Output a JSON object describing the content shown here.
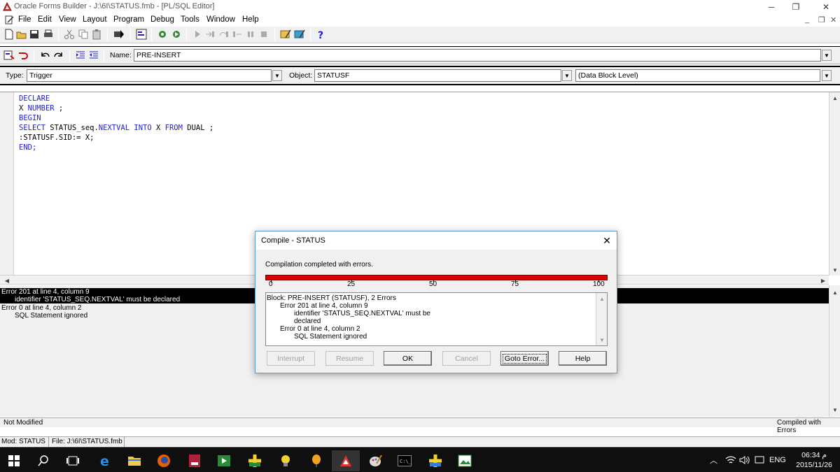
{
  "window": {
    "title": "Oracle Forms Builder - J:\\6I\\STATUS.fmb - [PL/SQL Editor]",
    "controls": {
      "minimize": "─",
      "restore": "❐",
      "close": "✕"
    }
  },
  "menu": {
    "items": [
      "File",
      "Edit",
      "View",
      "Layout",
      "Program",
      "Debug",
      "Tools",
      "Window",
      "Help"
    ],
    "mdi": {
      "minimize": "_",
      "restore": "❐",
      "close": "✕"
    }
  },
  "editor_header": {
    "name_label": "Name:",
    "name_value": "PRE-INSERT",
    "type_label": "Type:",
    "type_value": "Trigger",
    "object_label": "Object:",
    "object_value": "STATUSF",
    "level_value": "(Data Block Level)"
  },
  "code": {
    "lines": [
      [
        {
          "t": "DECLARE",
          "k": true
        }
      ],
      [
        {
          "t": "X ",
          "k": false
        },
        {
          "t": "NUMBER",
          "k": true
        },
        {
          "t": " ;",
          "k": false
        }
      ],
      [
        {
          "t": "BEGIN",
          "k": true
        }
      ],
      [
        {
          "t": "SELECT",
          "k": true
        },
        {
          "t": " STATUS_seq.",
          "k": false
        },
        {
          "t": "NEXTVAL",
          "k": true
        },
        {
          "t": " ",
          "k": false
        },
        {
          "t": "INTO",
          "k": true
        },
        {
          "t": " X ",
          "k": false
        },
        {
          "t": "FROM",
          "k": true
        },
        {
          "t": " DUAL ;",
          "k": false
        }
      ],
      [
        {
          "t": ":STATUSF.SID:= X;",
          "k": false
        }
      ],
      [
        {
          "t": "END;",
          "k": true
        }
      ]
    ]
  },
  "errors": {
    "lines": [
      "Error 201 at line 4, column 9",
      "identifier 'STATUS_SEQ.NEXTVAL' must be declared",
      "Error 0 at line 4, column 2",
      "SQL Statement ignored"
    ]
  },
  "status": {
    "left": "Not Modified",
    "right": "Compiled with Errors",
    "module": "Mod: STATUS",
    "file": "File: J:\\6I\\STATUS.fmb"
  },
  "dialog": {
    "title": "Compile - STATUS",
    "message": "Compilation completed with errors.",
    "progress": {
      "value_percent": 100,
      "ticks": [
        "0",
        "25",
        "50",
        "75",
        "100"
      ],
      "color": "#e00000"
    },
    "details": [
      "Block: PRE-INSERT (STATUSF), 2 Errors",
      "Error 201 at line 4, column 9",
      "identifier 'STATUS_SEQ.NEXTVAL' must be",
      "declared",
      "Error 0 at line 4, column 2",
      "SQL Statement ignored"
    ],
    "buttons": {
      "interrupt": "Interrupt",
      "resume": "Resume",
      "ok": "OK",
      "cancel": "Cancel",
      "goto_error": "Goto Error...",
      "help": "Help"
    }
  },
  "taskbar": {
    "time": "06:34",
    "ampm": "م",
    "date": "2015/11/26",
    "lang": "ENG",
    "icons": [
      "windows-start",
      "search",
      "task-view",
      "edge",
      "file-explorer",
      "firefox",
      "media-app",
      "media-player",
      "oracle-forms",
      "oracle-lightbulb",
      "oracle-balloon",
      "oracle-builder-active",
      "paint-app",
      "command-prompt",
      "oracle-net",
      "image-app"
    ]
  }
}
